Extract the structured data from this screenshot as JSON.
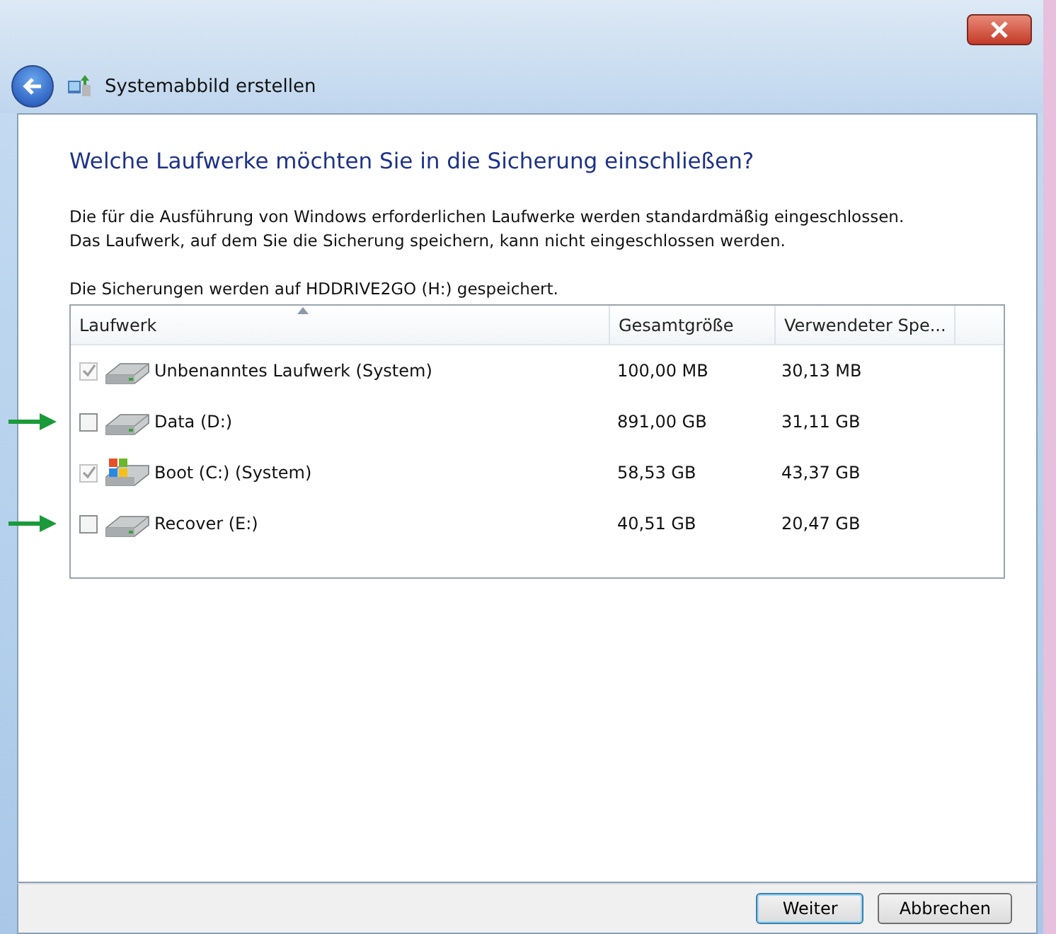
{
  "window": {
    "title": "Systemabbild erstellen"
  },
  "heading": "Welche Laufwerke möchten Sie in die Sicherung einschließen?",
  "description": [
    "Die für die Ausführung von Windows erforderlichen Laufwerke werden standardmäßig eingeschlossen.",
    "Das Laufwerk, auf dem Sie die Sicherung speichern, kann nicht eingeschlossen werden."
  ],
  "destination": "Die Sicherungen werden auf HDDRIVE2GO (H:) gespeichert.",
  "table": {
    "columns": [
      "Laufwerk",
      "Gesamtgröße",
      "Verwendeter Spe..."
    ],
    "rows": [
      {
        "kind": "drive",
        "name": "Unbenanntes Laufwerk (System)",
        "total": "100,00 MB",
        "used": "30,13 MB",
        "checked": true,
        "disabled": true,
        "marked": false
      },
      {
        "kind": "drive",
        "name": "Data (D:)",
        "total": "891,00 GB",
        "used": "31,11 GB",
        "checked": false,
        "disabled": false,
        "marked": true
      },
      {
        "kind": "windows",
        "name": "Boot (C:) (System)",
        "total": "58,53 GB",
        "used": "43,37 GB",
        "checked": true,
        "disabled": true,
        "marked": false
      },
      {
        "kind": "drive",
        "name": "Recover (E:)",
        "total": "40,51 GB",
        "used": "20,47 GB",
        "checked": false,
        "disabled": false,
        "marked": true
      }
    ]
  },
  "buttons": [
    {
      "label": "Weiter",
      "default": true
    },
    {
      "label": "Abbrechen",
      "default": false
    }
  ]
}
